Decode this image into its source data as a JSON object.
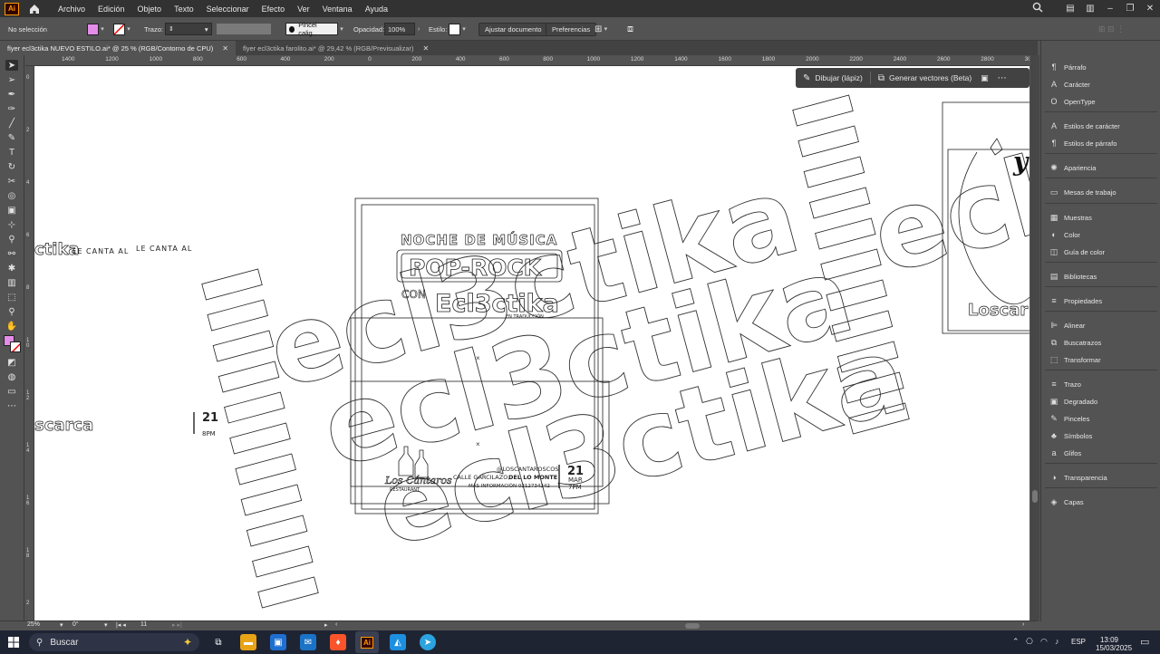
{
  "app": {
    "logo": "Ai"
  },
  "menu": [
    "Archivo",
    "Edición",
    "Objeto",
    "Texto",
    "Seleccionar",
    "Efecto",
    "Ver",
    "Ventana",
    "Ayuda"
  ],
  "control": {
    "selection": "No selección",
    "fill_color": "#e58ce8",
    "stroke_label": "Trazo:",
    "brush": "Pincel calig...",
    "opacity_label": "Opacidad:",
    "opacity_value": "100%",
    "style_label": "Estilo:",
    "fit_button": "Ajustar documento",
    "prefs_button": "Preferencias"
  },
  "tabs": [
    {
      "label": "flyer ecl3ctika NUEVO ESTILO.ai* @ 25 % (RGB/Contorno de CPU)",
      "active": true
    },
    {
      "label": "flyer ecl3ctika farolito.ai* @ 29,42 % (RGB/Previsualizar)",
      "active": false
    }
  ],
  "ruler_top": [
    "1400",
    "1200",
    "1000",
    "800",
    "600",
    "400",
    "200",
    "0",
    "200",
    "400",
    "600",
    "800",
    "1000",
    "1200",
    "1400",
    "1600",
    "1800",
    "2000",
    "2200",
    "2400",
    "2600",
    "2800",
    "3000"
  ],
  "ruler_left": [
    "0",
    "2",
    "4",
    "6",
    "8",
    "1 0",
    "1 2",
    "1 4",
    "1 6",
    "1 8",
    "2"
  ],
  "context_bar": {
    "draw": "Dibujar (lápiz)",
    "vectors": "Generar vectores (Beta)"
  },
  "artwork": {
    "header": "NOCHE DE MÚSICA",
    "title": "POP-ROCK",
    "con": "CON",
    "brand": "Ecl3ctika",
    "brand_small": "EN TRADUCCIÓN",
    "watermark": "ecl3ctika",
    "left_text1": "LE CANTA AL",
    "left_text2": "LE CANTA AL",
    "left_fragment": "ctika",
    "left_word": "scarca",
    "left_date_num": "21",
    "left_date_time": "8PM",
    "handle": "@LOSCANTAROSCOS",
    "address_pre": "CALLE GARCILAZO,",
    "address_bold": "DEL LO MONTE",
    "info": "MÁS INFORMACIÓN 0212734242",
    "date_num": "21",
    "date_month": "MAR",
    "date_time": "7PM",
    "venue": "Los Cántaros",
    "venue_sub": "RESTAURANT",
    "right_frag1": "y",
    "right_frag2": "Loscar"
  },
  "panels": [
    {
      "label": "Párrafo",
      "icon": "paragraph-icon",
      "glyph": "¶"
    },
    {
      "label": "Carácter",
      "icon": "character-icon",
      "glyph": "A"
    },
    {
      "label": "OpenType",
      "icon": "opentype-icon",
      "glyph": "O"
    },
    {
      "label": "Estilos de carácter",
      "icon": "character-styles-icon",
      "glyph": "A"
    },
    {
      "label": "Estilos de párrafo",
      "icon": "paragraph-styles-icon",
      "glyph": "¶"
    },
    {
      "label": "Apariencia",
      "icon": "appearance-icon",
      "glyph": "✺"
    },
    {
      "label": "Mesas de trabajo",
      "icon": "artboards-icon",
      "glyph": "▭"
    },
    {
      "label": "Muestras",
      "icon": "swatches-icon",
      "glyph": "▦"
    },
    {
      "label": "Color",
      "icon": "color-icon",
      "glyph": "◐"
    },
    {
      "label": "Guía de color",
      "icon": "color-guide-icon",
      "glyph": "◫"
    },
    {
      "label": "Bibliotecas",
      "icon": "libraries-icon",
      "glyph": "▤"
    },
    {
      "label": "Propiedades",
      "icon": "properties-icon",
      "glyph": "≡"
    },
    {
      "label": "Alinear",
      "icon": "align-icon",
      "glyph": "⊫"
    },
    {
      "label": "Buscatrazos",
      "icon": "pathfinder-icon",
      "glyph": "⧉"
    },
    {
      "label": "Transformar",
      "icon": "transform-icon",
      "glyph": "⬚"
    },
    {
      "label": "Trazo",
      "icon": "stroke-icon",
      "glyph": "≡"
    },
    {
      "label": "Degradado",
      "icon": "gradient-icon",
      "glyph": "▣"
    },
    {
      "label": "Pinceles",
      "icon": "brushes-icon",
      "glyph": "✎"
    },
    {
      "label": "Símbolos",
      "icon": "symbols-icon",
      "glyph": "♣"
    },
    {
      "label": "Glifos",
      "icon": "glyphs-icon",
      "glyph": "a"
    },
    {
      "label": "Transparencia",
      "icon": "transparency-icon",
      "glyph": "◑"
    },
    {
      "label": "Capas",
      "icon": "layers-icon",
      "glyph": "◈"
    }
  ],
  "status": {
    "zoom": "25%",
    "rotation": "0°",
    "artboard": "11"
  },
  "taskbar": {
    "search": "Buscar",
    "lang": "ESP",
    "time": "13:09",
    "date": "15/03/2025"
  }
}
